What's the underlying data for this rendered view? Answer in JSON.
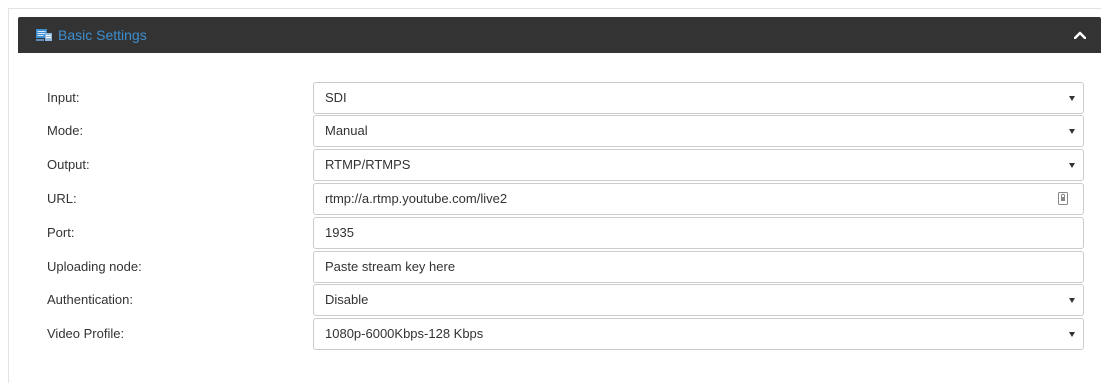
{
  "panel": {
    "title": "Basic Settings",
    "icon": "settings-panel-icon",
    "collapse_icon": "chevron-up-icon"
  },
  "colors": {
    "header_bg": "#333333",
    "title_color": "#3d8fd1"
  },
  "fields": {
    "input": {
      "label": "Input:",
      "value": "SDI"
    },
    "mode": {
      "label": "Mode:",
      "value": "Manual"
    },
    "output": {
      "label": "Output:",
      "value": "RTMP/RTMPS"
    },
    "url": {
      "label": "URL:",
      "value": "rtmp://a.rtmp.youtube.com/live2"
    },
    "port": {
      "label": "Port:",
      "value": "1935"
    },
    "uploading_node": {
      "label": "Uploading node:",
      "placeholder": "Paste stream key here"
    },
    "authentication": {
      "label": "Authentication:",
      "value": "Disable"
    },
    "video_profile": {
      "label": "Video Profile:",
      "value": "1080p-6000Kbps-128 Kbps"
    }
  }
}
